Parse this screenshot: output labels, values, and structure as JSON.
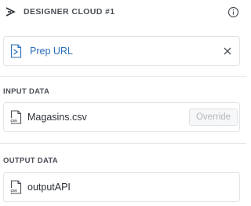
{
  "header": {
    "title": "DESIGNER CLOUD #1",
    "logo_icon": "designer-cloud-logo-icon",
    "info_icon": "info-icon"
  },
  "prep_url": {
    "label": "Prep URL",
    "icon": "prep-url-icon",
    "close_icon": "close-icon",
    "color": "#2a6ebb"
  },
  "input_data": {
    "title": "INPUT DATA",
    "file_name": "Magasins.csv",
    "file_icon": "csv-file-icon",
    "override_label": "Override"
  },
  "output_data": {
    "title": "OUTPUT DATA",
    "file_name": "outputAPI",
    "file_icon": "csv-file-icon"
  }
}
